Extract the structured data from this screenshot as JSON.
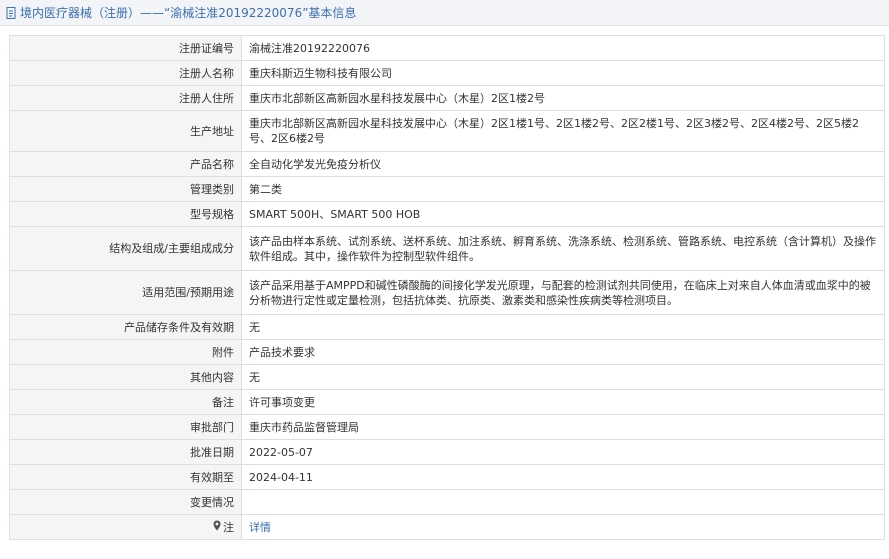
{
  "header": {
    "title": "境内医疗器械（注册）——“渝械注准20192220076”基本信息"
  },
  "rows": [
    {
      "label": "注册证编号",
      "value": "渝械注准20192220076"
    },
    {
      "label": "注册人名称",
      "value": "重庆科斯迈生物科技有限公司"
    },
    {
      "label": "注册人住所",
      "value": "重庆市北部新区高新园水星科技发展中心（木星）2区1楼2号"
    },
    {
      "label": "生产地址",
      "value": "重庆市北部新区高新园水星科技发展中心（木星）2区1楼1号、2区1楼2号、2区2楼1号、2区3楼2号、2区4楼2号、2区5楼2号、2区6楼2号"
    },
    {
      "label": "产品名称",
      "value": "全自动化学发光免疫分析仪"
    },
    {
      "label": "管理类别",
      "value": "第二类"
    },
    {
      "label": "型号规格",
      "value": "SMART 500H、SMART 500 HOB"
    },
    {
      "label": "结构及组成/主要组成成分",
      "value": "该产品由样本系统、试剂系统、送杯系统、加注系统、孵育系统、洗涤系统、检测系统、管路系统、电控系统（含计算机）及操作软件组成。其中，操作软件为控制型软件组件。"
    },
    {
      "label": "适用范围/预期用途",
      "value": "该产品采用基于AMPPD和碱性磷酸酶的间接化学发光原理，与配套的检测试剂共同使用，在临床上对来自人体血清或血浆中的被分析物进行定性或定量检测，包括抗体类、抗原类、激素类和感染性疾病类等检测项目。"
    },
    {
      "label": "产品储存条件及有效期",
      "value": "无"
    },
    {
      "label": "附件",
      "value": "产品技术要求"
    },
    {
      "label": "其他内容",
      "value": "无"
    },
    {
      "label": "备注",
      "value": "许可事项变更"
    },
    {
      "label": "审批部门",
      "value": "重庆市药品监督管理局"
    },
    {
      "label": "批准日期",
      "value": "2022-05-07"
    },
    {
      "label": "有效期至",
      "value": "2024-04-11"
    },
    {
      "label": "变更情况",
      "value": ""
    }
  ],
  "note": {
    "label": "注",
    "link": "详情",
    "icon": "location-pin-icon"
  },
  "colors": {
    "link": "#3a6fb0",
    "label_bg": "#f5f5f5",
    "border": "#dcdfe3",
    "header_bg": "#f2f4f7"
  }
}
